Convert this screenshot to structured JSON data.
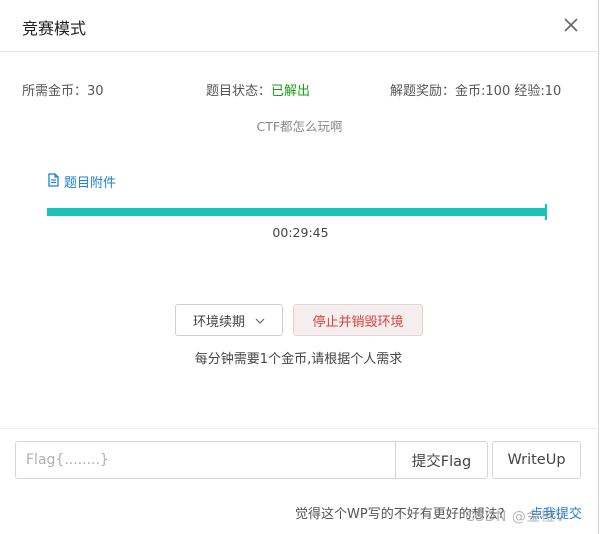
{
  "dialog": {
    "title": "竞赛模式",
    "close_icon": "close-icon"
  },
  "info": {
    "cost_label": "所需金币：",
    "cost_value": "30",
    "status_label": "题目状态：",
    "status_value": "已解出",
    "status_color": "#17a317",
    "reward_label": "解题奖励：",
    "reward_value": "金币:100 经验:10"
  },
  "challenge": {
    "description": "CTF都怎么玩啊"
  },
  "attachment": {
    "icon": "file-icon",
    "label": "题目附件"
  },
  "environment": {
    "progress_fraction": 1.0,
    "progress_color": "#19c3b8",
    "timer": "00:29:45",
    "renew_label": "环境续期",
    "renew_icon": "chevron-down-icon",
    "stop_label": "停止并销毁环境",
    "notice": "每分钟需要1个金币,请根据个人需求"
  },
  "flag_form": {
    "placeholder": "Flag{........}",
    "value": "",
    "submit_label": "提交Flag",
    "writeup_label": "WriteUp"
  },
  "footer": {
    "question": "觉得这个WP写的不好有更好的想法?",
    "link_label": "点我提交",
    "watermark": "CSDN @金橙V"
  }
}
